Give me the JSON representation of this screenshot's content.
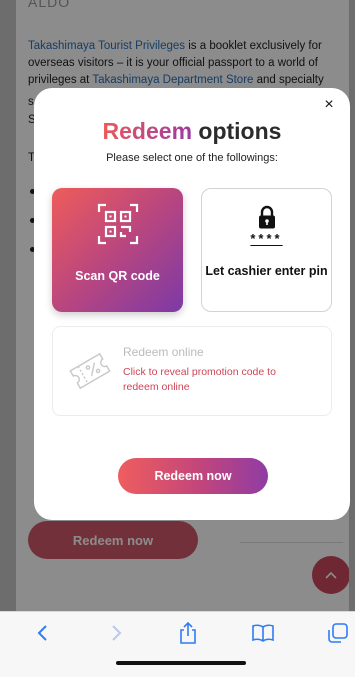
{
  "background_page": {
    "brand": "ALDO",
    "paragraph": {
      "link1": "Takashimaya Tourist Privileges",
      "text1": " is a booklet exclusively for overseas visitors – it is your official passport to a world of privileges at ",
      "link2": "Takashimaya Department Store",
      "text2": " and specialty"
    },
    "fragment_s1": "s",
    "fragment_s2": "S",
    "fragment_t": "T",
    "redeem_button_label": "Redeem now"
  },
  "modal": {
    "title_accent": "Redeem",
    "title_rest": " options",
    "subtitle": "Please select one of the followings:",
    "close_label": "×",
    "options": [
      {
        "label": "Scan QR code",
        "icon": "qr-code-icon"
      },
      {
        "label": "Let cashier enter pin",
        "icon": "lock-icon",
        "pin_mask": "****"
      }
    ],
    "online": {
      "title": "Redeem online",
      "description": "Click to reveal promotion code to redeem online",
      "icon": "coupon-icon"
    },
    "redeem_button_label": "Redeem now"
  },
  "colors": {
    "accent_red": "#ef5c5a",
    "accent_purple": "#7c3aa6",
    "link_blue": "#2a6fb5",
    "promo_red": "#cf4557"
  },
  "toolbar": {
    "icons": [
      "back-icon",
      "forward-icon",
      "share-icon",
      "bookmarks-icon",
      "tabs-icon"
    ]
  }
}
